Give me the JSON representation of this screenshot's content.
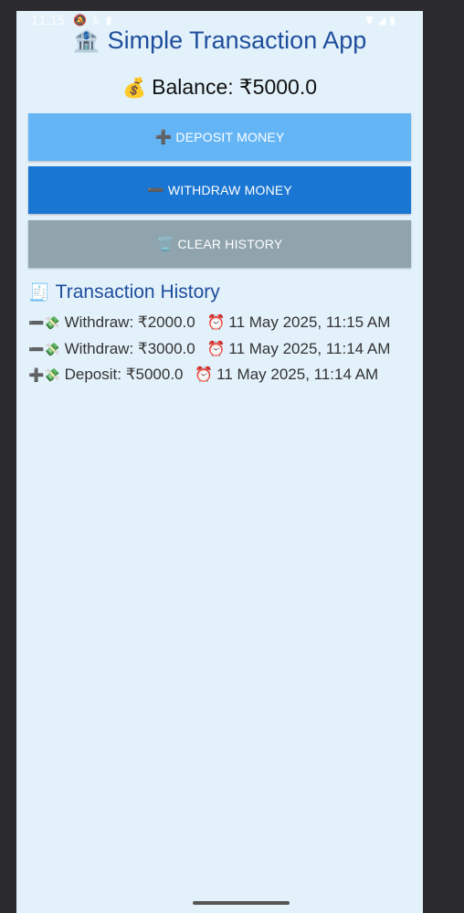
{
  "status_bar": {
    "time": "11:15",
    "left_icons": [
      "🔕",
      "♿",
      "▮"
    ],
    "right_icons": [
      "▼",
      "◢",
      "▮"
    ]
  },
  "header": {
    "title_icon": "🏦",
    "title": "Simple Transaction App"
  },
  "balance": {
    "icon": "💰",
    "label": "Balance: ₹5000.0"
  },
  "buttons": {
    "deposit": {
      "icon": "➕",
      "label": "DEPOSIT MONEY"
    },
    "withdraw": {
      "icon": "➖",
      "label": "WITHDRAW MONEY"
    },
    "clear": {
      "icon": "🗑️",
      "label": "CLEAR HISTORY"
    }
  },
  "history": {
    "icon": "🧾",
    "title": "Transaction History",
    "items": [
      {
        "type_icon": "➖💸",
        "text": "Withdraw: ₹2000.0",
        "clock_icon": "⏰",
        "time": "11 May 2025, 11:15 AM"
      },
      {
        "type_icon": "➖💸",
        "text": "Withdraw: ₹3000.0",
        "clock_icon": "⏰",
        "time": "11 May 2025, 11:14 AM"
      },
      {
        "type_icon": "➕💸",
        "text": "Deposit: ₹5000.0",
        "clock_icon": "⏰",
        "time": "11 May 2025, 11:14 AM"
      }
    ]
  },
  "colors": {
    "background": "#e3f1fb",
    "title": "#1f4e9c",
    "deposit_button": "#64b5f6",
    "withdraw_button": "#1976d2",
    "clear_button": "#90a4ae"
  }
}
